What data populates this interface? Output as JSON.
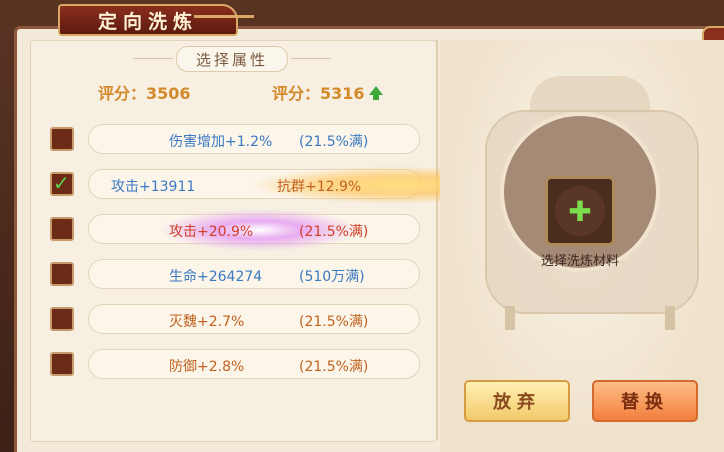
{
  "window": {
    "title": "定向洗炼",
    "close_icon": "close-icon"
  },
  "attributes_panel": {
    "section_title": "选择属性",
    "score_left": "评分：3506",
    "score_right": "评分：5316",
    "score_trend": "up-arrow-icon",
    "rows": [
      {
        "checked": false,
        "attr": "伤害增加+1.2%",
        "note": "(21.5%满)"
      },
      {
        "checked": true,
        "attr": "攻击+13911",
        "note": "抗群+12.9%"
      },
      {
        "checked": false,
        "attr": "攻击+20.9%",
        "note": "(21.5%满)"
      },
      {
        "checked": false,
        "attr": "生命+264274",
        "note": "(510万满)"
      },
      {
        "checked": false,
        "attr": "灭魏+2.7%",
        "note": "(21.5%满)"
      },
      {
        "checked": false,
        "attr": "防御+2.8%",
        "note": "(21.5%满)"
      }
    ]
  },
  "material": {
    "label": "选择洗炼材料",
    "add_icon": "plus-icon"
  },
  "buttons": {
    "abandon": "放弃",
    "replace": "替换"
  },
  "colors": {
    "score": "#d48a2a",
    "blue_attr": "#3b79c2",
    "red_attr": "#d0402a",
    "brown_attr": "#c2621e"
  }
}
